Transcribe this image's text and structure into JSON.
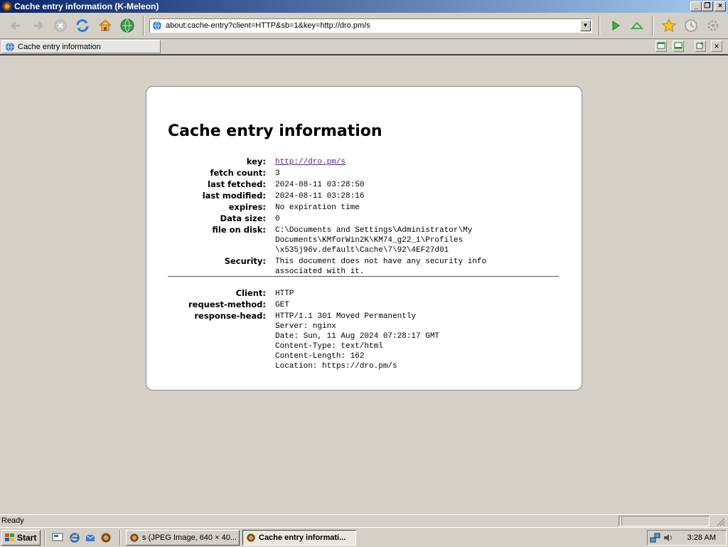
{
  "window": {
    "title": "Cache entry information (K-Meleon)",
    "controls": [
      "minimize",
      "restore",
      "close"
    ]
  },
  "toolbar": {
    "buttons": [
      "back-icon",
      "forward-icon",
      "stop-icon",
      "reload-icon",
      "home-icon",
      "globe-icon"
    ],
    "address": "about:cache-entry?client=HTTP&sb=1&key=http://dro.pm/s",
    "right_buttons": [
      "go-icon",
      "up-icon",
      "bookmarks-icon",
      "history-icon",
      "settings-icon"
    ]
  },
  "tab": {
    "label": "Cache entry information"
  },
  "page": {
    "heading": "Cache entry information",
    "entries": [
      {
        "label": "key:",
        "value": "http://dro.pm/s",
        "link": true
      },
      {
        "label": "fetch count:",
        "value": "3"
      },
      {
        "label": "last fetched:",
        "value": "2024-08-11 03:28:50"
      },
      {
        "label": "last modified:",
        "value": "2024-08-11 03:28:16"
      },
      {
        "label": "expires:",
        "value": "No expiration time"
      },
      {
        "label": "Data size:",
        "value": "0"
      },
      {
        "label": "file on disk:",
        "value": "C:\\Documents and Settings\\Administrator\\My\nDocuments\\KMforWin2K\\KM74_g22_1\\Profiles\n\\x535j96v.default\\Cache\\7\\92\\4EF27d01"
      },
      {
        "label": "Security:",
        "value": "This document does not have any security info\nassociated with it."
      }
    ],
    "http": [
      {
        "label": "Client:",
        "value": "HTTP"
      },
      {
        "label": "request-method:",
        "value": "GET"
      },
      {
        "label": "response-head:",
        "value": "HTTP/1.1 301 Moved Permanently\nServer: nginx\nDate: Sun, 11 Aug 2024 07:28:17 GMT\nContent-Type: text/html\nContent-Length: 162\nLocation: https://dro.pm/s"
      }
    ]
  },
  "statusbar": {
    "text": "Ready"
  },
  "taskbar": {
    "start_label": "Start",
    "tasks": [
      {
        "label": "s (JPEG Image, 640 × 40...",
        "active": false
      },
      {
        "label": "Cache entry informati...",
        "active": true
      }
    ],
    "clock": "3:28 AM"
  }
}
